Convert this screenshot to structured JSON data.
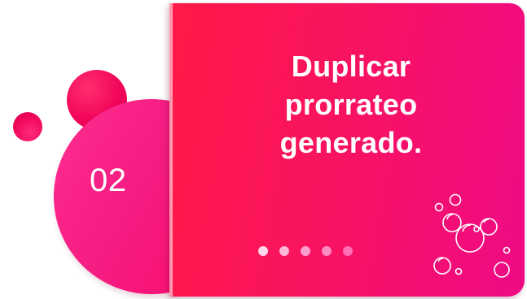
{
  "slide": {
    "step_number": "02",
    "title_lines": [
      "Duplicar",
      "prorrateo",
      "generado."
    ],
    "pager_count": 5,
    "colors": {
      "accent_red": "#ff1a48",
      "accent_magenta": "#ef0a86",
      "circle_pink": "#f51c82"
    },
    "icons": [
      "bubbles-icon"
    ]
  }
}
